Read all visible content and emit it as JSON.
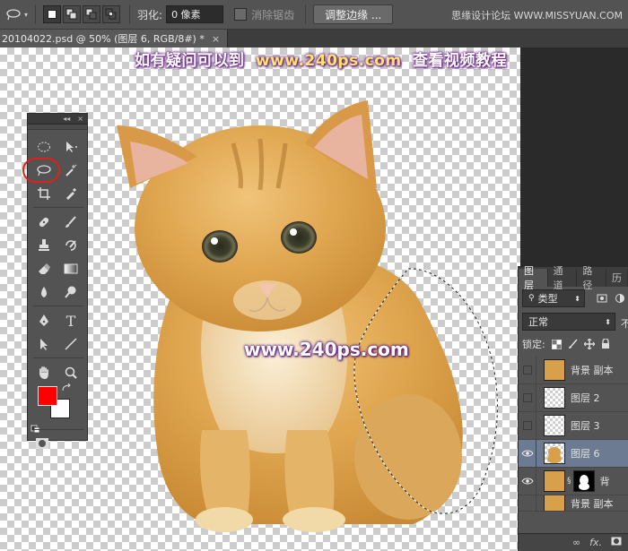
{
  "options_bar": {
    "feather_label": "羽化:",
    "feather_value": "0 像素",
    "antialias_label": "消除锯齿",
    "refine_edge_button": "调整边缘 ...",
    "site_watermark": "思缘设计论坛 WWW.MISSYUAN.COM"
  },
  "document": {
    "tab_title": "20104022.psd @ 50% (图层 6, RGB/8#) *",
    "close_glyph": "×"
  },
  "canvas": {
    "tutorial_text_prefix": "如有疑问可以到",
    "tutorial_text_url": "www.240ps.com",
    "tutorial_text_suffix": "查看视频教程",
    "center_watermark": "www.240ps.com"
  },
  "tools_panel": {
    "collapse_glyph": "◂◂",
    "close_glyph": "×",
    "foreground_color": "#ff0000",
    "background_color": "#ffffff",
    "text_tool_glyph": "T"
  },
  "layers_panel": {
    "tabs": [
      "图层",
      "通道",
      "路径",
      "历"
    ],
    "filter_kind": "类型",
    "blend_mode": "正常",
    "opacity_label": "不",
    "lock_label": "锁定:",
    "layers": [
      {
        "name": "背景 副本",
        "thumb": "cat",
        "selected": false,
        "visible": false
      },
      {
        "name": "图层 2",
        "thumb": "transparent",
        "selected": false,
        "visible": false
      },
      {
        "name": "图层 3",
        "thumb": "transparent",
        "selected": false,
        "visible": false
      },
      {
        "name": "图层 6",
        "thumb": "cat-cutout",
        "selected": true,
        "visible": true
      },
      {
        "name": "背",
        "thumb": "cat-mask",
        "selected": false,
        "visible": true
      },
      {
        "name": "背景 副本",
        "thumb": "cat",
        "selected": false,
        "visible": true
      }
    ],
    "footer": {
      "link_glyph": "∞",
      "fx_label": "fx."
    }
  }
}
